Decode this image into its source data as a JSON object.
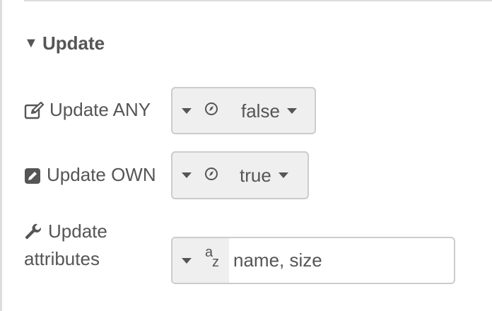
{
  "section": {
    "caret_glyph": "▼",
    "title": "Update"
  },
  "rows": {
    "update_any": {
      "icon": "edit-icon",
      "label": "Update ANY",
      "value": "false"
    },
    "update_own": {
      "icon": "edit-filled-icon",
      "label": "Update OWN",
      "value": "true"
    },
    "update_attributes": {
      "icon": "wrench-icon",
      "label_line1": "Update",
      "label_line2": "attributes",
      "type_icon": "az-string-icon",
      "type_glyph_a": "a",
      "type_glyph_z": "z",
      "value": "name, size"
    }
  },
  "colors": {
    "text": "#555555",
    "select_bg": "#efefef",
    "border": "#cccccc",
    "divider": "#dddddd"
  }
}
